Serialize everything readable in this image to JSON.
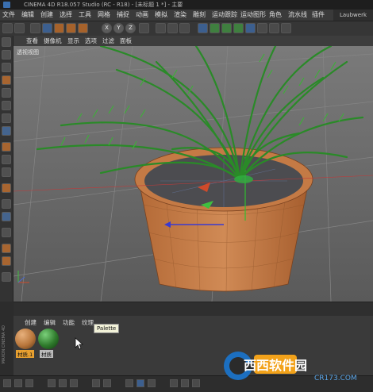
{
  "window": {
    "title": "CINEMA 4D R18.057 Studio (RC - R18) - [未标题 1 *] - 主要"
  },
  "menubar": {
    "items": [
      "文件",
      "编辑",
      "创建",
      "选择",
      "工具",
      "网格",
      "捕捉",
      "动画",
      "模拟",
      "渲染",
      "雕刻",
      "运动跟踪",
      "运动图形",
      "角色",
      "流水线",
      "插件"
    ],
    "layout_label": "Laubwerk"
  },
  "viewport_menu": {
    "items": [
      "查看",
      "摄像机",
      "显示",
      "选项",
      "过滤",
      "面板"
    ]
  },
  "viewport": {
    "label": "透视视图"
  },
  "material_panel": {
    "menu": [
      "创建",
      "编辑",
      "功能",
      "纹理"
    ],
    "tooltip": "Palette",
    "materials": [
      {
        "name": "材质.1",
        "color": "#b9773c"
      },
      {
        "name": "材质",
        "color": "#2f7a2c"
      }
    ]
  },
  "watermark": {
    "brand": "西西软件园",
    "url": "CR173.COM"
  },
  "side_label": "MAXON CINEMA 4D",
  "colors": {
    "pot": "#c47a45",
    "leaf": "#2d8a2a",
    "viewport_bg": "#6f6f6f"
  }
}
